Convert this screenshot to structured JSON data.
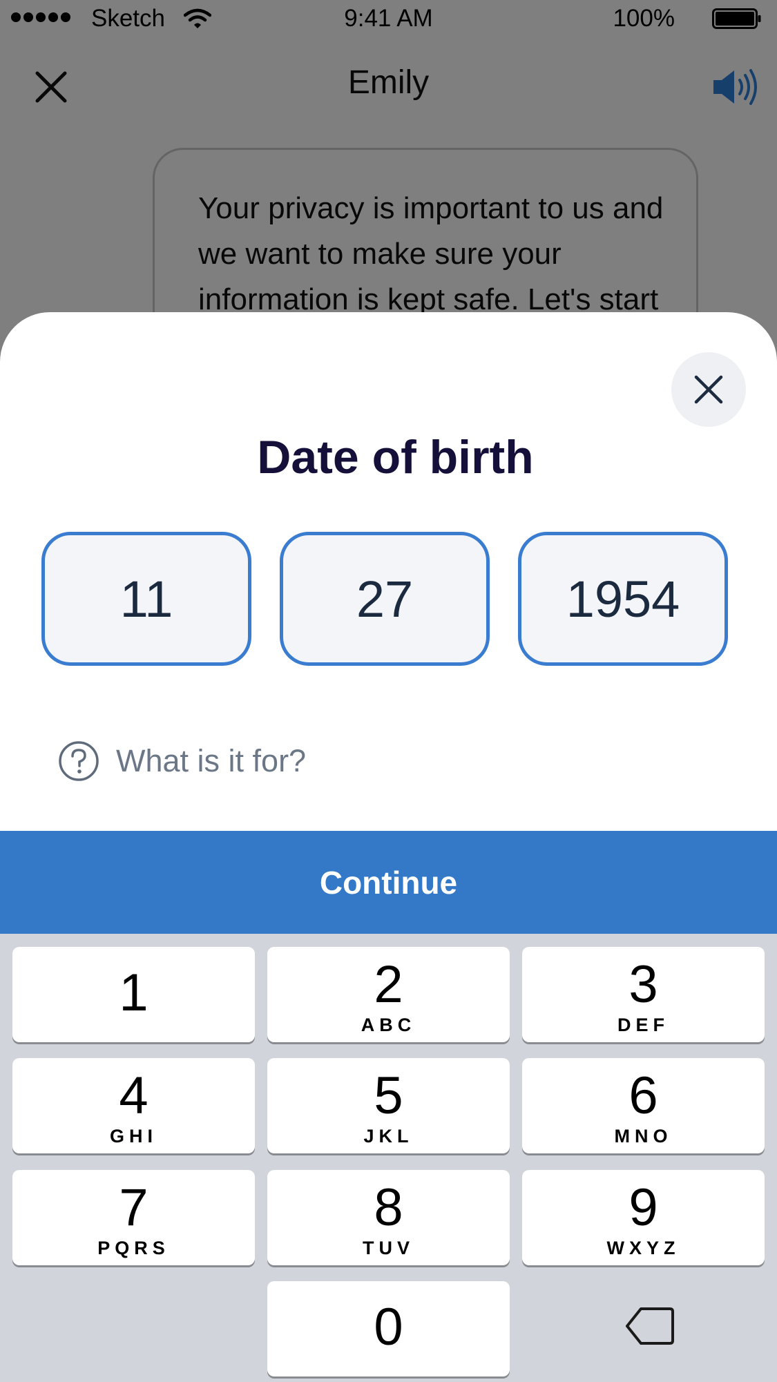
{
  "status_bar": {
    "carrier": "Sketch",
    "time": "9:41 AM",
    "battery": "100%"
  },
  "chat": {
    "title": "Emily",
    "message": "Your privacy is important to us and we want to make sure your information is kept safe. Let's start"
  },
  "sheet": {
    "title": "Date of birth",
    "month": "11",
    "day": "27",
    "year": "1954",
    "help_text": "What is it for?",
    "continue_label": "Continue"
  },
  "keypad": {
    "keys": [
      {
        "num": "1",
        "letters": ""
      },
      {
        "num": "2",
        "letters": "ABC"
      },
      {
        "num": "3",
        "letters": "DEF"
      },
      {
        "num": "4",
        "letters": "GHI"
      },
      {
        "num": "5",
        "letters": "JKL"
      },
      {
        "num": "6",
        "letters": "MNO"
      },
      {
        "num": "7",
        "letters": "PQRS"
      },
      {
        "num": "8",
        "letters": "TUV"
      },
      {
        "num": "9",
        "letters": "WXYZ"
      },
      {
        "num": "0",
        "letters": ""
      }
    ]
  },
  "icons": {
    "nav_close": "close-icon",
    "speaker": "speaker-icon",
    "sheet_close": "close-icon",
    "help": "question-circle-icon",
    "backspace": "backspace-icon"
  },
  "colors": {
    "accent": "#3478c8",
    "title": "#15103a",
    "field_border": "#3a7cd0"
  }
}
